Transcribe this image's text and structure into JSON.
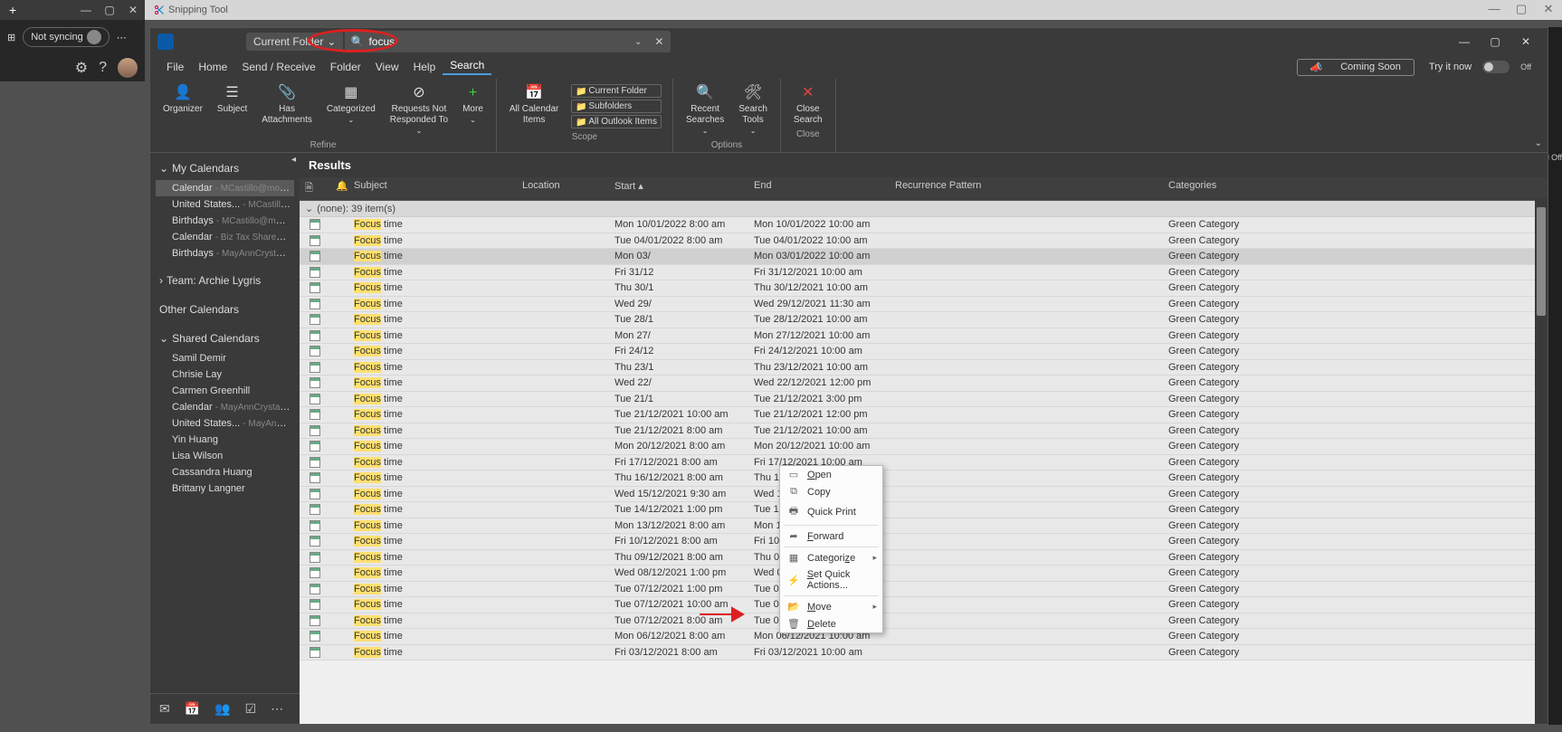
{
  "browser": {
    "snip_label": "Snipping Tool",
    "not_syncing": "Not syncing"
  },
  "ol": {
    "search_scope": "Current Folder",
    "search_value": "focus",
    "menu": [
      "File",
      "Home",
      "Send / Receive",
      "Folder",
      "View",
      "Help",
      "Search"
    ],
    "coming_soon": "Coming Soon",
    "try_it": "Try it now",
    "off": "Off"
  },
  "ribbon": {
    "refine": {
      "organizer": "Organizer",
      "subject": "Subject",
      "has_att": "Has\nAttachments",
      "categorized": "Categorized",
      "req": "Requests Not\nResponded To",
      "more": "More",
      "label": "Refine"
    },
    "scope": {
      "all_cal": "All Calendar\nItems",
      "cf": "Current Folder",
      "sf": "Subfolders",
      "aoi": "All Outlook Items",
      "label": "Scope"
    },
    "options": {
      "recent": "Recent\nSearches",
      "tools": "Search\nTools",
      "label": "Options"
    },
    "close": {
      "close": "Close\nSearch",
      "label": "Close"
    }
  },
  "nav": {
    "my_cal": "My Calendars",
    "my_items": [
      {
        "name": "Calendar",
        "sub": "- MCastillo@morrow..."
      },
      {
        "name": "United States...",
        "sub": "- MCastillo@..."
      },
      {
        "name": "Birthdays",
        "sub": "- MCastillo@morrow..."
      },
      {
        "name": "Calendar",
        "sub": "- Biz Tax Shared Cale..."
      },
      {
        "name": "Birthdays",
        "sub": "- MayAnnCrystalyn.C..."
      }
    ],
    "team": "Team: Archie Lygris",
    "other": "Other Calendars",
    "shared": "Shared Calendars",
    "shared_items": [
      {
        "name": "Samil Demir"
      },
      {
        "name": "Chrisie Lay"
      },
      {
        "name": "Carmen Greenhill"
      },
      {
        "name": "Calendar",
        "sub": "- MayAnnCrystalyn.C..."
      },
      {
        "name": "United States...",
        "sub": "- MayAnnCrys..."
      },
      {
        "name": "Yin Huang"
      },
      {
        "name": "Lisa Wilson"
      },
      {
        "name": "Cassandra Huang"
      },
      {
        "name": "Brittany Langner"
      }
    ]
  },
  "results": {
    "title": "Results",
    "cols": {
      "subject": "Subject",
      "location": "Location",
      "start": "Start",
      "end": "End",
      "recur": "Recurrence Pattern",
      "cat": "Categories"
    },
    "group": "(none): 39 item(s)",
    "subj_hl": "Focus",
    "subj_rest": " time",
    "category": "Green Category",
    "rows": [
      {
        "start": "Mon 10/01/2022 8:00 am",
        "end": "Mon 10/01/2022 10:00 am"
      },
      {
        "start": "Tue 04/01/2022 8:00 am",
        "end": "Tue 04/01/2022 10:00 am"
      },
      {
        "start": "Mon 03/",
        "end": "Mon 03/01/2022 10:00 am"
      },
      {
        "start": "Fri 31/12",
        "end": "Fri 31/12/2021 10:00 am"
      },
      {
        "start": "Thu 30/1",
        "end": "Thu 30/12/2021 10:00 am"
      },
      {
        "start": "Wed 29/",
        "end": "Wed 29/12/2021 11:30 am"
      },
      {
        "start": "Tue 28/1",
        "end": "Tue 28/12/2021 10:00 am"
      },
      {
        "start": "Mon 27/",
        "end": "Mon 27/12/2021 10:00 am"
      },
      {
        "start": "Fri 24/12",
        "end": "Fri 24/12/2021 10:00 am"
      },
      {
        "start": "Thu 23/1",
        "end": "Thu 23/12/2021 10:00 am"
      },
      {
        "start": "Wed 22/",
        "end": "Wed 22/12/2021 12:00 pm"
      },
      {
        "start": "Tue 21/1",
        "end": "Tue 21/12/2021 3:00 pm"
      },
      {
        "start": "Tue 21/12/2021 10:00 am",
        "end": "Tue 21/12/2021 12:00 pm"
      },
      {
        "start": "Tue 21/12/2021 8:00 am",
        "end": "Tue 21/12/2021 10:00 am"
      },
      {
        "start": "Mon 20/12/2021 8:00 am",
        "end": "Mon 20/12/2021 10:00 am"
      },
      {
        "start": "Fri 17/12/2021 8:00 am",
        "end": "Fri 17/12/2021 10:00 am"
      },
      {
        "start": "Thu 16/12/2021 8:00 am",
        "end": "Thu 16/12/2021 10:00 am"
      },
      {
        "start": "Wed 15/12/2021 9:30 am",
        "end": "Wed 15/12/2021 11:30 am"
      },
      {
        "start": "Tue 14/12/2021 1:00 pm",
        "end": "Tue 14/12/2021 3:00 pm"
      },
      {
        "start": "Mon 13/12/2021 8:00 am",
        "end": "Mon 13/12/2021 10:00 am"
      },
      {
        "start": "Fri 10/12/2021 8:00 am",
        "end": "Fri 10/12/2021 10:00 am"
      },
      {
        "start": "Thu 09/12/2021 8:00 am",
        "end": "Thu 09/12/2021 10:00 am"
      },
      {
        "start": "Wed 08/12/2021 1:00 pm",
        "end": "Wed 08/12/2021 3:00 pm"
      },
      {
        "start": "Tue 07/12/2021 1:00 pm",
        "end": "Tue 07/12/2021 3:00 pm"
      },
      {
        "start": "Tue 07/12/2021 10:00 am",
        "end": "Tue 07/12/2021 12:00 pm"
      },
      {
        "start": "Tue 07/12/2021 8:00 am",
        "end": "Tue 07/12/2021 10:00 am"
      },
      {
        "start": "Mon 06/12/2021 8:00 am",
        "end": "Mon 06/12/2021 10:00 am"
      },
      {
        "start": "Fri 03/12/2021 8:00 am",
        "end": "Fri 03/12/2021 10:00 am"
      }
    ]
  },
  "ctx": {
    "open": "Open",
    "copy": "Copy",
    "quick_print": "Quick Print",
    "forward": "Forward",
    "categorize": "Categorize",
    "set_quick": "Set Quick Actions...",
    "move": "Move",
    "delete": "Delete"
  },
  "right": {
    "off": "Off"
  }
}
